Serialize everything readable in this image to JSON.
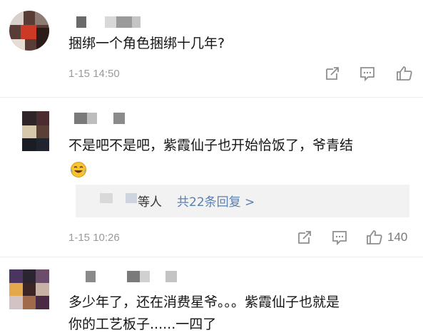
{
  "comments": [
    {
      "text": "捆绑一个角色捆绑十几年?",
      "time": "1-15 14:50"
    },
    {
      "text_line1": "不是吧不是吧，紫霞仙子也开始恰饭了，爷青结",
      "emoji": "laughing-tears-emoji",
      "reply": {
        "suffix": "等人",
        "link": "共22条回复 >"
      },
      "time": "1-15 10:26",
      "likes": "140"
    },
    {
      "text_line1": "多少年了，还在消费星爷。。。紫霞仙子也就是",
      "text_line2": "你的工艺板子......一四了"
    }
  ],
  "colors": {
    "text": "#151515",
    "meta": "#9a9a9a",
    "link": "#5b7fb0",
    "reply_bg": "#f2f2f2"
  }
}
